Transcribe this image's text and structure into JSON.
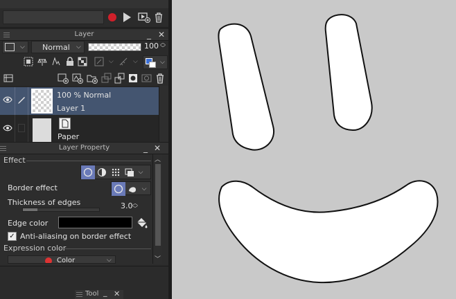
{
  "action_toolbar": {
    "icons": [
      "record-icon",
      "play-icon",
      "new-action-icon",
      "trash-icon"
    ]
  },
  "layer_panel": {
    "title": "Layer",
    "blend_mode": "Normal",
    "opacity": "100",
    "layers": [
      {
        "info": "100 % Normal",
        "name": "Layer 1",
        "selected": true
      },
      {
        "info": "",
        "name": "Paper",
        "selected": false
      }
    ]
  },
  "layer_property_panel": {
    "title": "Layer Property",
    "effect_label": "Effect",
    "border_effect_label": "Border effect",
    "thickness_label": "Thickness of edges",
    "thickness_value": "3.0",
    "edge_color_label": "Edge color",
    "edge_color": "#000000",
    "antialias_label": "Anti-aliasing on border effect",
    "antialias_checked": true,
    "expression_color_label": "Expression color",
    "expression_color_value": "Color"
  },
  "tool_panel": {
    "title": "Tool"
  },
  "colors": {
    "accent": "#6a7ab8",
    "selected_row": "#445570",
    "record": "#d0202a"
  }
}
